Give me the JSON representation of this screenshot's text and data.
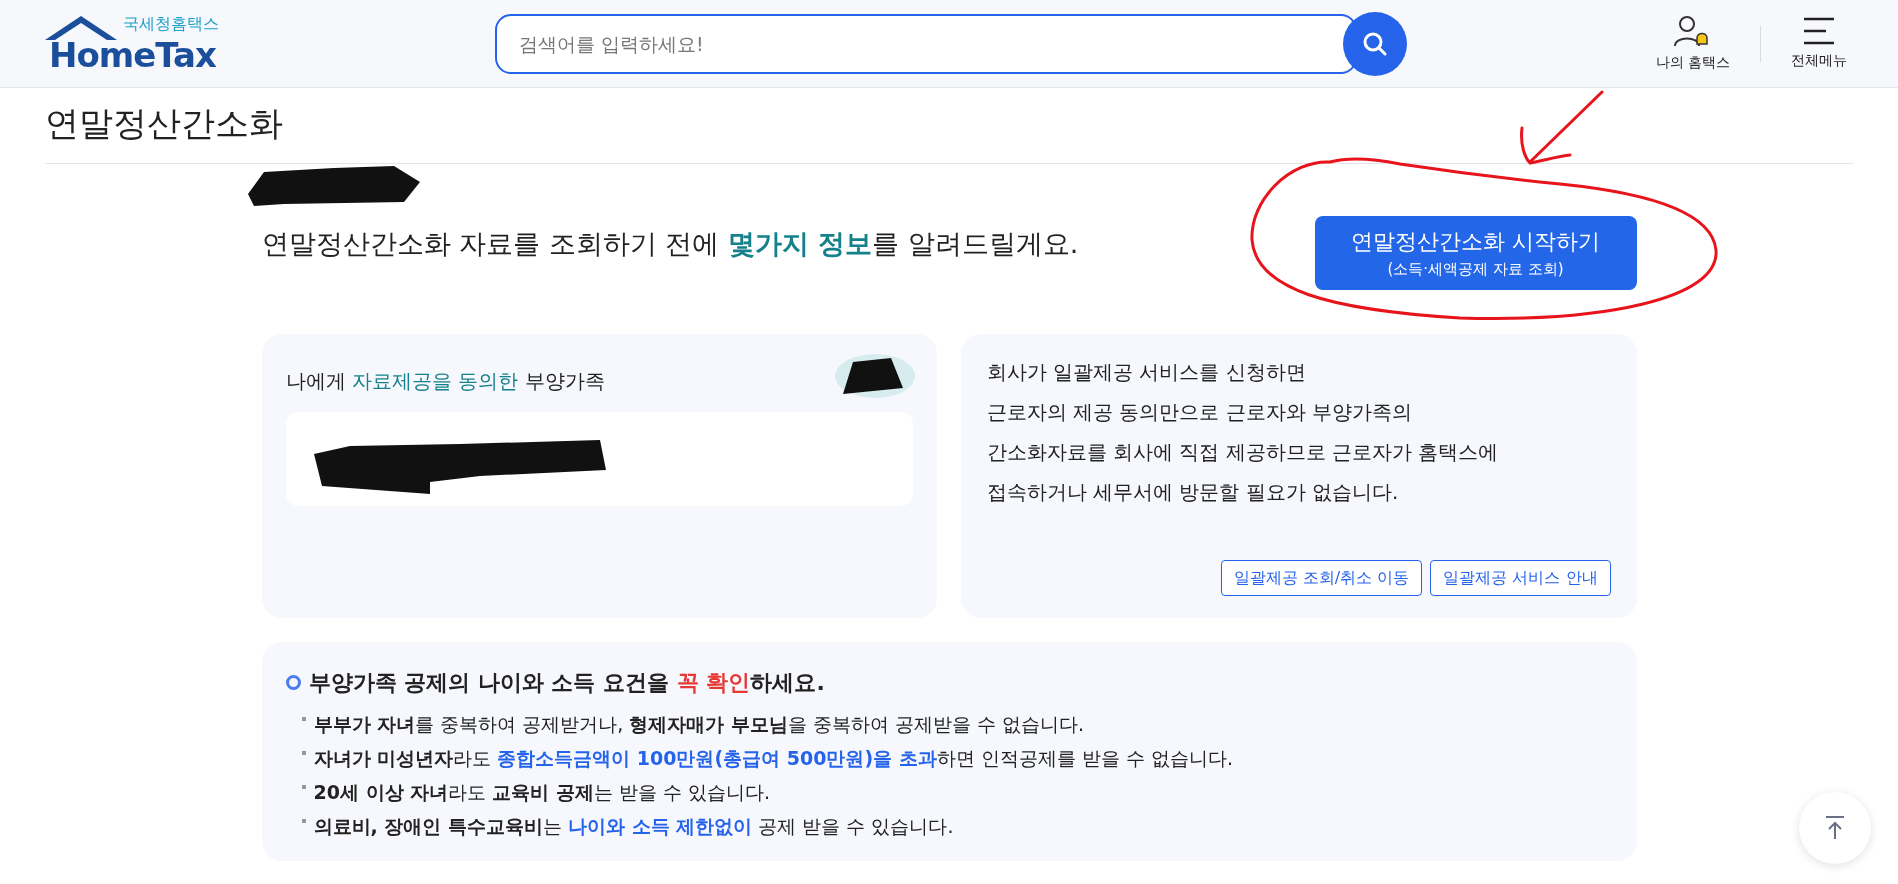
{
  "header": {
    "logo": {
      "caption": "국세청홈택스",
      "name": "HomeTax"
    },
    "search": {
      "placeholder": "검색어를 입력하세요!"
    },
    "nav": [
      {
        "kind": "user",
        "label": "나의 홈택스"
      },
      {
        "kind": "menu",
        "label": "전체메뉴"
      }
    ]
  },
  "page_title": "연말정산간소화",
  "intro": [
    {
      "kind": "plain",
      "text": "연말정산간소화 자료를 조회하기 전에 "
    },
    {
      "kind": "accent",
      "text": "몇가지 정보"
    },
    {
      "kind": "plain",
      "text": "를 알려드릴게요."
    }
  ],
  "start_button": {
    "title": "연말정산간소화 시작하기",
    "subtitle": "(소득·세액공제 자료 조회)"
  },
  "consent_card": {
    "title": [
      {
        "kind": "plain",
        "text": "나에게 "
      },
      {
        "kind": "teal",
        "text": "자료제공을 동의한"
      },
      {
        "kind": "plain",
        "text": " 부양가족"
      }
    ]
  },
  "info_card": {
    "lines": [
      "회사가 일괄제공 서비스를 신청하면",
      "근로자의 제공 동의만으로 근로자와 부양가족의",
      "간소화자료를 회사에 직접 제공하므로 근로자가 홈택스에",
      "접속하거나 세무서에 방문할 필요가 없습니다."
    ],
    "buttons": [
      "일괄제공 조회/취소 이동",
      "일괄제공 서비스 안내"
    ]
  },
  "notice": {
    "heading": [
      {
        "kind": "plain",
        "text": "부양가족 공제의 나이와 소득 요건을 "
      },
      {
        "kind": "alert",
        "text": "꼭 확인"
      },
      {
        "kind": "plain",
        "text": "하세요."
      }
    ],
    "items": [
      [
        {
          "kind": "bold",
          "text": "부부가 자녀"
        },
        {
          "kind": "plain",
          "text": "를 중복하여 공제받거나, "
        },
        {
          "kind": "bold",
          "text": "형제자매가 부모님"
        },
        {
          "kind": "plain",
          "text": "을 중복하여 공제받을 수 없습니다."
        }
      ],
      [
        {
          "kind": "bold",
          "text": "자녀가 미성년자"
        },
        {
          "kind": "plain",
          "text": "라도 "
        },
        {
          "kind": "blue",
          "text": "종합소득금액이 100만원(총급여 500만원)을 초과"
        },
        {
          "kind": "plain",
          "text": "하면 인적공제를 받을 수 없습니다."
        }
      ],
      [
        {
          "kind": "bold",
          "text": "20세 이상 자녀"
        },
        {
          "kind": "plain",
          "text": "라도 "
        },
        {
          "kind": "bold",
          "text": "교육비 공제"
        },
        {
          "kind": "plain",
          "text": "는 받을 수 있습니다."
        }
      ],
      [
        {
          "kind": "bold",
          "text": "의료비, 장애인 특수교육비"
        },
        {
          "kind": "plain",
          "text": "는 "
        },
        {
          "kind": "blue",
          "text": "나이와 소득 제한없이"
        },
        {
          "kind": "plain",
          "text": " 공제 받을 수 있습니다."
        }
      ]
    ]
  }
}
